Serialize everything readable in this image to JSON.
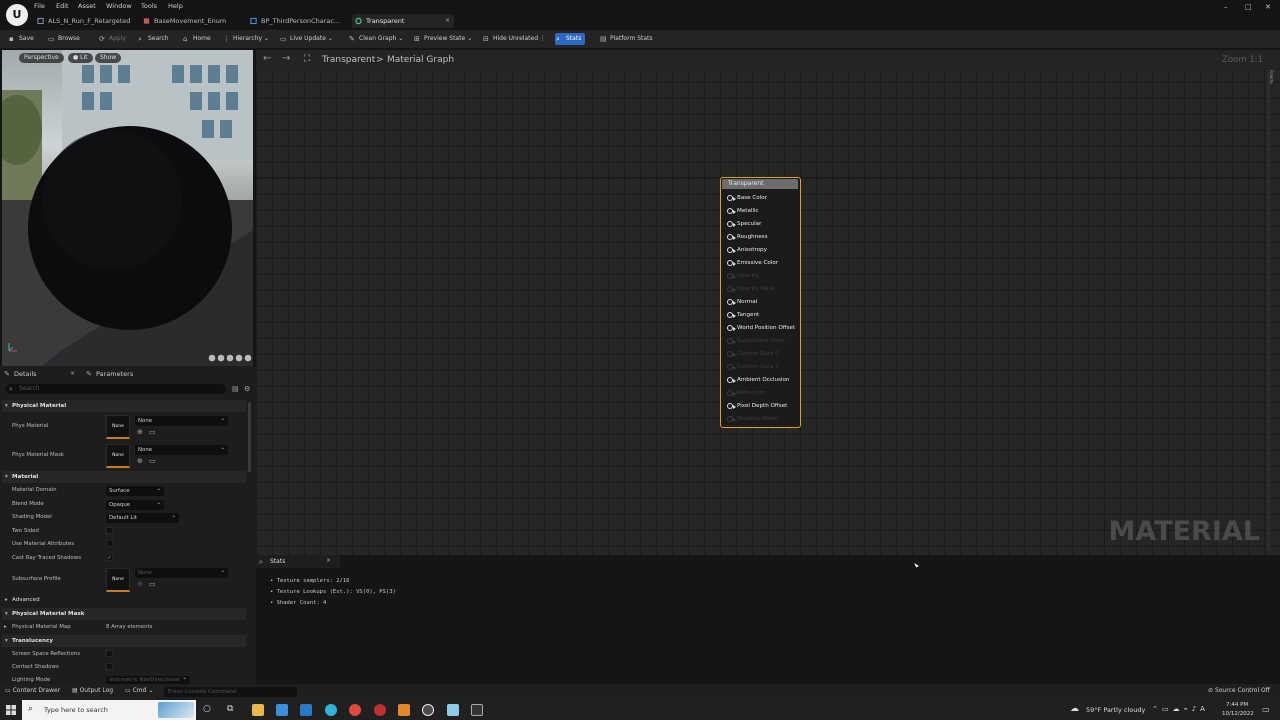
{
  "titlebar": {
    "menu": [
      "File",
      "Edit",
      "Asset",
      "Window",
      "Tools",
      "Help"
    ],
    "tabs": [
      {
        "label": "ALS_N_Run_F_Retargeted",
        "icon": "animation-icon",
        "active": false
      },
      {
        "label": "BaseMovement_Enum",
        "icon": "enum-icon",
        "active": false
      },
      {
        "label": "BP_ThirdPersonCharac...",
        "icon": "blueprint-icon",
        "active": false
      },
      {
        "label": "Transparent",
        "icon": "material-icon",
        "active": true
      }
    ],
    "tab_close": "×",
    "window_controls": {
      "minimize": "–",
      "maximize": "□",
      "close": "✕"
    }
  },
  "toolbar": {
    "save": "Save",
    "browse": "Browse",
    "apply": "Apply",
    "search": "Search",
    "home": "Home",
    "hierarchy": "Hierarchy",
    "live_update": "Live Update",
    "clean_graph": "Clean Graph",
    "preview_state": "Preview State",
    "hide_unrelated": "Hide Unrelated",
    "stats": "Stats",
    "platform_stats": "Platform Stats"
  },
  "viewport": {
    "perspective": "Perspective",
    "lit": "Lit",
    "show": "Show"
  },
  "details": {
    "tab_details": "Details",
    "tab_parameters": "Parameters",
    "search_placeholder": "Search",
    "sections": {
      "physical_material": "Physical Material",
      "material": "Material",
      "advanced": "Advanced",
      "physical_material_mask": "Physical Material Mask",
      "translucency": "Translucency"
    },
    "props": {
      "phys_material": {
        "label": "Phys Material",
        "value": "None",
        "thumb": "None"
      },
      "phys_material_mask": {
        "label": "Phys Material Mask",
        "value": "None",
        "thumb": "None"
      },
      "material_domain": {
        "label": "Material Domain",
        "value": "Surface"
      },
      "blend_mode": {
        "label": "Blend Mode",
        "value": "Opaque"
      },
      "shading_model": {
        "label": "Shading Model",
        "value": "Default Lit"
      },
      "two_sided": {
        "label": "Two Sided",
        "checked": false
      },
      "use_material_attributes": {
        "label": "Use Material Attributes",
        "checked": false
      },
      "cast_ray_traced_shadows": {
        "label": "Cast Ray Traced Shadows",
        "checked": true
      },
      "subsurface_profile": {
        "label": "Subsurface Profile",
        "value": "None",
        "thumb": "None"
      },
      "physical_material_map": {
        "label": "Physical Material Map",
        "value": "8 Array elements"
      },
      "screen_space_reflections": {
        "label": "Screen Space Reflections"
      },
      "contact_shadows": {
        "label": "Contact Shadows"
      },
      "lighting_mode": {
        "label": "Lighting Mode",
        "value": "Volumetric NonDirectional"
      }
    },
    "checkmark": "✓"
  },
  "graph": {
    "breadcrumb_root": "Transparent",
    "breadcrumb_sep": ">",
    "breadcrumb_leaf": "Material Graph",
    "zoom": "Zoom 1:1",
    "palette": "Palette",
    "watermark": "MATERIAL",
    "node": {
      "title": "Transparent",
      "pins": [
        {
          "label": "Base Color",
          "enabled": true
        },
        {
          "label": "Metallic",
          "enabled": true
        },
        {
          "label": "Specular",
          "enabled": true
        },
        {
          "label": "Roughness",
          "enabled": true
        },
        {
          "label": "Anisotropy",
          "enabled": true
        },
        {
          "label": "Emissive Color",
          "enabled": true
        },
        {
          "label": "Opacity",
          "enabled": false
        },
        {
          "label": "Opacity Mask",
          "enabled": false
        },
        {
          "label": "Normal",
          "enabled": true
        },
        {
          "label": "Tangent",
          "enabled": true
        },
        {
          "label": "World Position Offset",
          "enabled": true
        },
        {
          "label": "Subsurface Color",
          "enabled": false
        },
        {
          "label": "Custom Data 0",
          "enabled": false
        },
        {
          "label": "Custom Data 1",
          "enabled": false
        },
        {
          "label": "Ambient Occlusion",
          "enabled": true
        },
        {
          "label": "Refraction",
          "enabled": false
        },
        {
          "label": "Pixel Depth Offset",
          "enabled": true
        },
        {
          "label": "Shading Model",
          "enabled": false
        }
      ]
    }
  },
  "stats": {
    "tab": "Stats",
    "close": "×",
    "lines": [
      "• Texture samplers: 2/16",
      "• Texture Lookups (Est.): VS(0), PS(3)",
      "• Shader Count: 4"
    ]
  },
  "bottombar": {
    "content_drawer": "Content Drawer",
    "output_log": "Output Log",
    "cmd": "Cmd",
    "console_placeholder": "Enter Console Command",
    "source_control": "Source Control Off"
  },
  "taskbar": {
    "search_placeholder": "Type here to search",
    "weather": "59°F  Partly cloudy",
    "time": "7:44 PM",
    "date": "10/12/2022"
  }
}
